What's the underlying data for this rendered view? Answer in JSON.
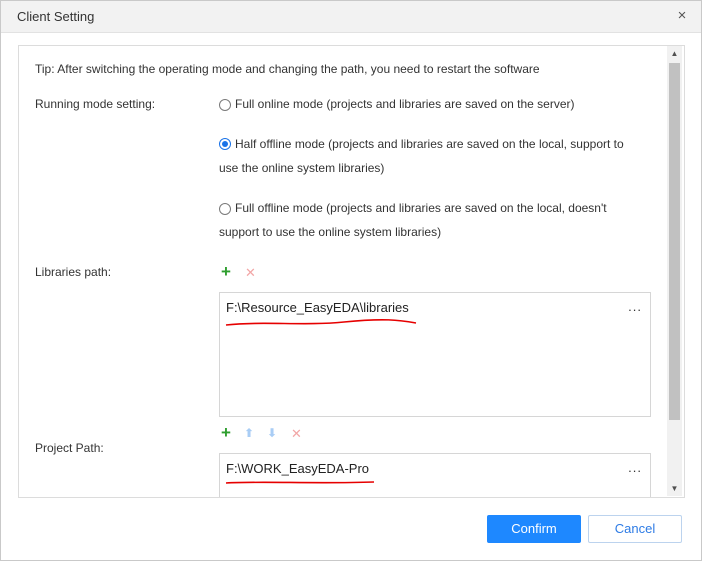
{
  "dialog": {
    "title": "Client Setting",
    "close_glyph": "×"
  },
  "tip": "Tip: After switching the operating mode and changing the path, you need to restart the software",
  "running_mode": {
    "label": "Running mode setting:",
    "options": [
      {
        "line1": "Full online mode (projects and libraries are saved on the server)",
        "line2": "",
        "checked": false
      },
      {
        "line1": "Half offline mode (projects and libraries are saved on the local, support to",
        "line2": "use the online system libraries)",
        "checked": true
      },
      {
        "line1": "Full offline mode (projects and libraries are saved on the local, doesn't",
        "line2": "support to use the online system libraries)",
        "checked": false
      }
    ]
  },
  "libraries": {
    "label": "Libraries path:",
    "add_glyph": "+",
    "remove_glyph": "✕",
    "path": "F:\\Resource_EasyEDA\\libraries",
    "more": "..."
  },
  "project": {
    "label": "Project Path:",
    "add_glyph": "+",
    "up_glyph": "⬆",
    "down_glyph": "⬇",
    "remove_glyph": "✕",
    "path": "F:\\WORK_EasyEDA-Pro",
    "more": "..."
  },
  "scrollbar": {
    "up_glyph": "▲",
    "down_glyph": "▼"
  },
  "buttons": {
    "confirm": "Confirm",
    "cancel": "Cancel"
  },
  "colors": {
    "accent": "#1e88ff",
    "radio_checked": "#1a73e8",
    "add_icon": "#2e9e2e",
    "remove_icon": "#f2a6a6",
    "arrow_icon": "#a9cdf5",
    "annotation_underline": "#e60000"
  }
}
